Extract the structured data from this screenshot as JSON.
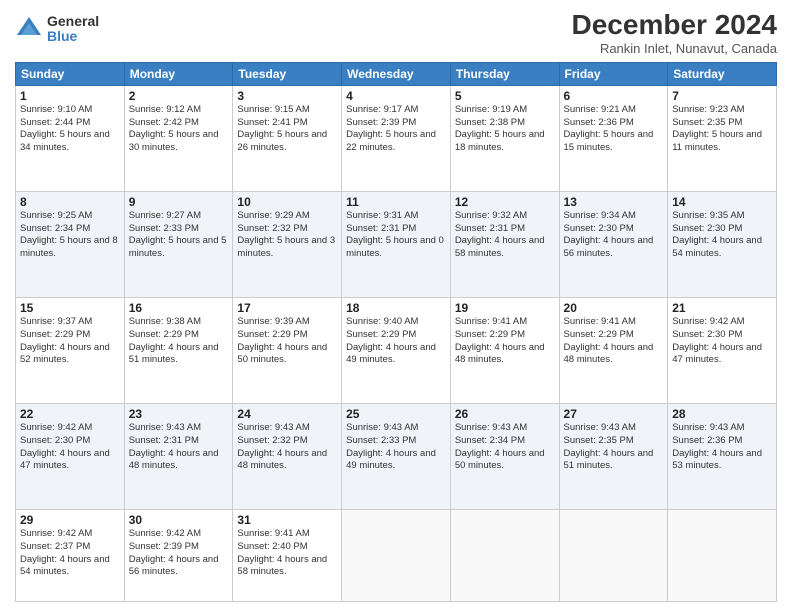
{
  "logo": {
    "general": "General",
    "blue": "Blue"
  },
  "title": "December 2024",
  "subtitle": "Rankin Inlet, Nunavut, Canada",
  "days_of_week": [
    "Sunday",
    "Monday",
    "Tuesday",
    "Wednesday",
    "Thursday",
    "Friday",
    "Saturday"
  ],
  "weeks": [
    [
      {
        "day": 1,
        "sunrise": "9:10 AM",
        "sunset": "2:44 PM",
        "daylight": "5 hours and 34 minutes."
      },
      {
        "day": 2,
        "sunrise": "9:12 AM",
        "sunset": "2:42 PM",
        "daylight": "5 hours and 30 minutes."
      },
      {
        "day": 3,
        "sunrise": "9:15 AM",
        "sunset": "2:41 PM",
        "daylight": "5 hours and 26 minutes."
      },
      {
        "day": 4,
        "sunrise": "9:17 AM",
        "sunset": "2:39 PM",
        "daylight": "5 hours and 22 minutes."
      },
      {
        "day": 5,
        "sunrise": "9:19 AM",
        "sunset": "2:38 PM",
        "daylight": "5 hours and 18 minutes."
      },
      {
        "day": 6,
        "sunrise": "9:21 AM",
        "sunset": "2:36 PM",
        "daylight": "5 hours and 15 minutes."
      },
      {
        "day": 7,
        "sunrise": "9:23 AM",
        "sunset": "2:35 PM",
        "daylight": "5 hours and 11 minutes."
      }
    ],
    [
      {
        "day": 8,
        "sunrise": "9:25 AM",
        "sunset": "2:34 PM",
        "daylight": "5 hours and 8 minutes."
      },
      {
        "day": 9,
        "sunrise": "9:27 AM",
        "sunset": "2:33 PM",
        "daylight": "5 hours and 5 minutes."
      },
      {
        "day": 10,
        "sunrise": "9:29 AM",
        "sunset": "2:32 PM",
        "daylight": "5 hours and 3 minutes."
      },
      {
        "day": 11,
        "sunrise": "9:31 AM",
        "sunset": "2:31 PM",
        "daylight": "5 hours and 0 minutes."
      },
      {
        "day": 12,
        "sunrise": "9:32 AM",
        "sunset": "2:31 PM",
        "daylight": "4 hours and 58 minutes."
      },
      {
        "day": 13,
        "sunrise": "9:34 AM",
        "sunset": "2:30 PM",
        "daylight": "4 hours and 56 minutes."
      },
      {
        "day": 14,
        "sunrise": "9:35 AM",
        "sunset": "2:30 PM",
        "daylight": "4 hours and 54 minutes."
      }
    ],
    [
      {
        "day": 15,
        "sunrise": "9:37 AM",
        "sunset": "2:29 PM",
        "daylight": "4 hours and 52 minutes."
      },
      {
        "day": 16,
        "sunrise": "9:38 AM",
        "sunset": "2:29 PM",
        "daylight": "4 hours and 51 minutes."
      },
      {
        "day": 17,
        "sunrise": "9:39 AM",
        "sunset": "2:29 PM",
        "daylight": "4 hours and 50 minutes."
      },
      {
        "day": 18,
        "sunrise": "9:40 AM",
        "sunset": "2:29 PM",
        "daylight": "4 hours and 49 minutes."
      },
      {
        "day": 19,
        "sunrise": "9:41 AM",
        "sunset": "2:29 PM",
        "daylight": "4 hours and 48 minutes."
      },
      {
        "day": 20,
        "sunrise": "9:41 AM",
        "sunset": "2:29 PM",
        "daylight": "4 hours and 48 minutes."
      },
      {
        "day": 21,
        "sunrise": "9:42 AM",
        "sunset": "2:30 PM",
        "daylight": "4 hours and 47 minutes."
      }
    ],
    [
      {
        "day": 22,
        "sunrise": "9:42 AM",
        "sunset": "2:30 PM",
        "daylight": "4 hours and 47 minutes."
      },
      {
        "day": 23,
        "sunrise": "9:43 AM",
        "sunset": "2:31 PM",
        "daylight": "4 hours and 48 minutes."
      },
      {
        "day": 24,
        "sunrise": "9:43 AM",
        "sunset": "2:32 PM",
        "daylight": "4 hours and 48 minutes."
      },
      {
        "day": 25,
        "sunrise": "9:43 AM",
        "sunset": "2:33 PM",
        "daylight": "4 hours and 49 minutes."
      },
      {
        "day": 26,
        "sunrise": "9:43 AM",
        "sunset": "2:34 PM",
        "daylight": "4 hours and 50 minutes."
      },
      {
        "day": 27,
        "sunrise": "9:43 AM",
        "sunset": "2:35 PM",
        "daylight": "4 hours and 51 minutes."
      },
      {
        "day": 28,
        "sunrise": "9:43 AM",
        "sunset": "2:36 PM",
        "daylight": "4 hours and 53 minutes."
      }
    ],
    [
      {
        "day": 29,
        "sunrise": "9:42 AM",
        "sunset": "2:37 PM",
        "daylight": "4 hours and 54 minutes."
      },
      {
        "day": 30,
        "sunrise": "9:42 AM",
        "sunset": "2:39 PM",
        "daylight": "4 hours and 56 minutes."
      },
      {
        "day": 31,
        "sunrise": "9:41 AM",
        "sunset": "2:40 PM",
        "daylight": "4 hours and 58 minutes."
      },
      null,
      null,
      null,
      null
    ]
  ]
}
